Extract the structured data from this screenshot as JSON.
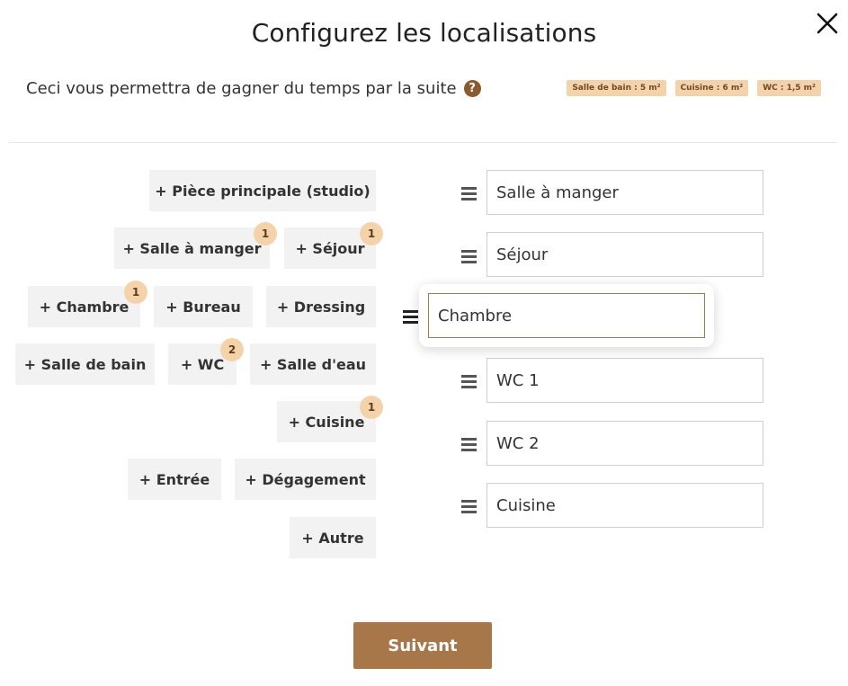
{
  "modal": {
    "title": "Configurez les localisations",
    "subtitle": "Ceci vous permettra de gagner du temps par la suite",
    "help_glyph": "?",
    "close_glyph": "close-icon",
    "accent_color": "#a87749",
    "badge_color": "#f4d3ab"
  },
  "area_chips": [
    "Salle de bain : 5 m²",
    "Cuisine : 6 m²",
    "WC : 1,5 m²"
  ],
  "room_buttons": [
    {
      "label": "+ Pièce principale (studio)",
      "count": ""
    },
    {
      "label": "+ Salle à manger",
      "count": "1"
    },
    {
      "label": "+ Séjour",
      "count": "1"
    },
    {
      "label": "+ Chambre",
      "count": "1"
    },
    {
      "label": "+ Bureau",
      "count": ""
    },
    {
      "label": "+ Dressing",
      "count": ""
    },
    {
      "label": "+ Salle de bain",
      "count": ""
    },
    {
      "label": "+ WC",
      "count": "2"
    },
    {
      "label": "+ Salle d'eau",
      "count": ""
    },
    {
      "label": "+ Cuisine",
      "count": "1"
    },
    {
      "label": "+ Entrée",
      "count": ""
    },
    {
      "label": "+ Dégagement",
      "count": ""
    },
    {
      "label": "+ Autre",
      "count": ""
    }
  ],
  "locations": [
    {
      "value": "Salle à manger",
      "dragging": false
    },
    {
      "value": "Séjour",
      "dragging": false
    },
    {
      "value": "Chambre",
      "dragging": true
    },
    {
      "value": "WC 1",
      "dragging": false
    },
    {
      "value": "WC 2",
      "dragging": false
    },
    {
      "value": "Cuisine",
      "dragging": false
    }
  ],
  "footer": {
    "next_label": "Suivant"
  }
}
